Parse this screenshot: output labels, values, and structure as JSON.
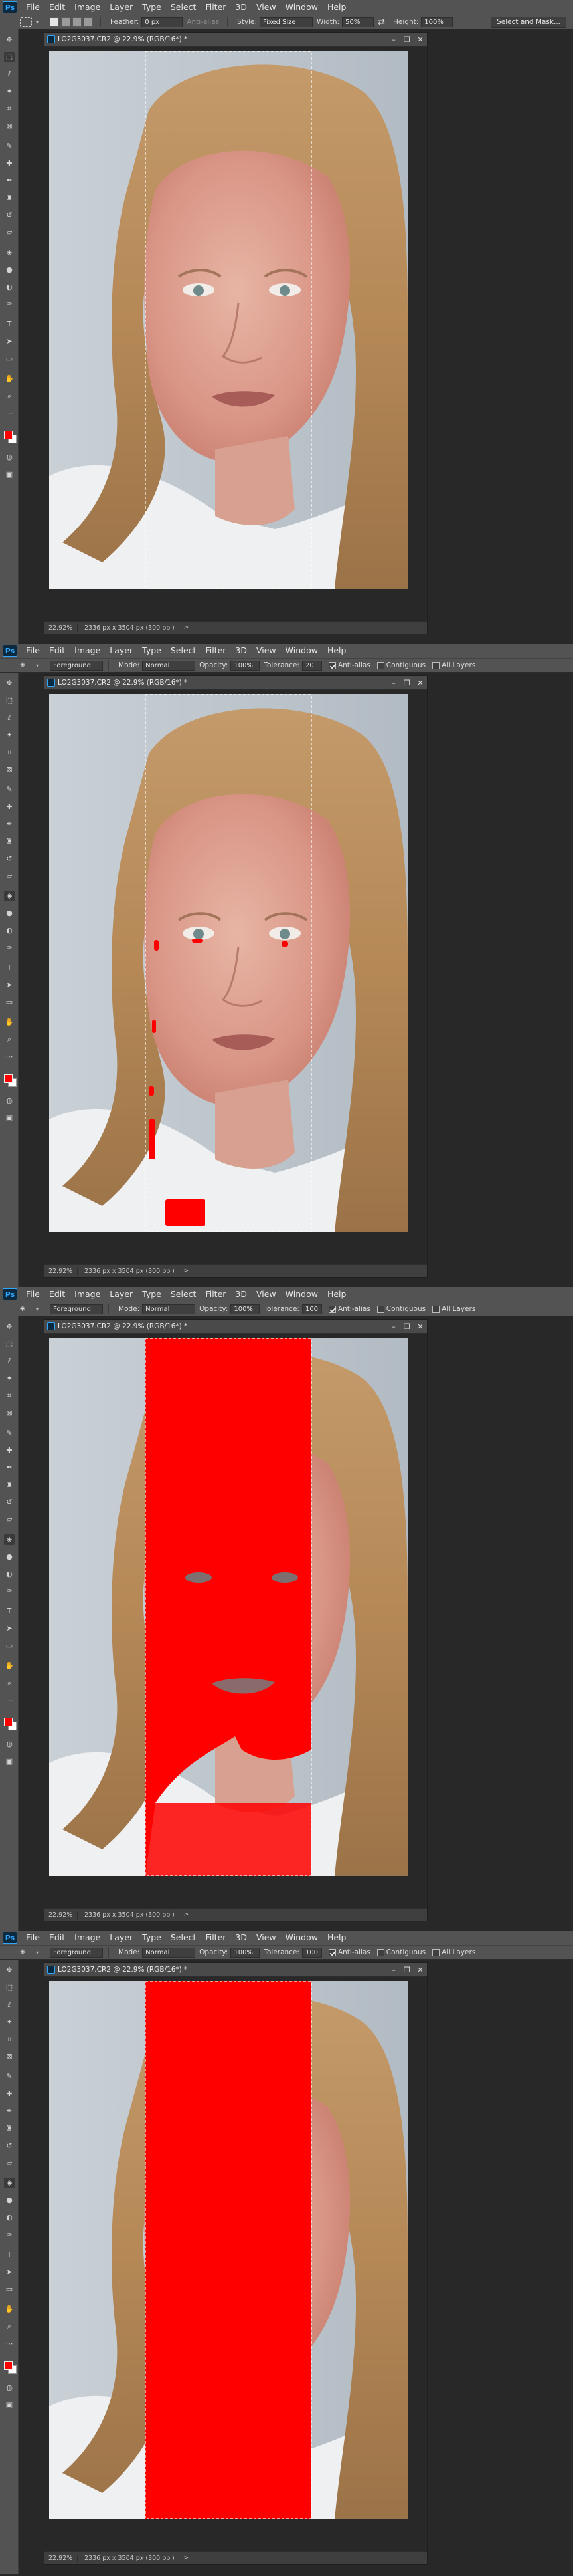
{
  "menu": [
    "File",
    "Edit",
    "Image",
    "Layer",
    "Type",
    "Select",
    "Filter",
    "3D",
    "View",
    "Window",
    "Help"
  ],
  "ps_logo": "Ps",
  "options_marquee": {
    "feather_label": "Feather:",
    "feather_value": "0 px",
    "antialias": "Anti-alias",
    "style_label": "Style:",
    "style_value": "Fixed Size",
    "width_label": "Width:",
    "width_value": "50%",
    "height_label": "Height:",
    "height_value": "100%",
    "select_mask": "Select and Mask..."
  },
  "options_fill": {
    "source_value": "Foreground",
    "mode_label": "Mode:",
    "mode_value": "Normal",
    "opacity_label": "Opacity:",
    "opacity_value": "100%",
    "tolerance_label": "Tolerance:",
    "antialias": "Anti-alias",
    "contiguous": "Contiguous",
    "all_layers": "All Layers"
  },
  "panels": [
    {
      "tolerance": "",
      "fill_stage": "none"
    },
    {
      "tolerance": "20",
      "fill_stage": "low"
    },
    {
      "tolerance": "100",
      "fill_stage": "mid"
    },
    {
      "tolerance": "100",
      "fill_stage": "full"
    }
  ],
  "document": {
    "title": "LO2G3037.CR2 @ 22.9% (RGB/16*) *",
    "zoom": "22.92%",
    "info": "2336 px x 3504 px (300 ppi)",
    "status_arrow": ">"
  },
  "window_controls": {
    "minimize": "–",
    "restore": "❐",
    "close": "✕"
  },
  "colors": {
    "foreground": "#ff0000",
    "background": "#ffffff",
    "fill": "#ff0000"
  }
}
